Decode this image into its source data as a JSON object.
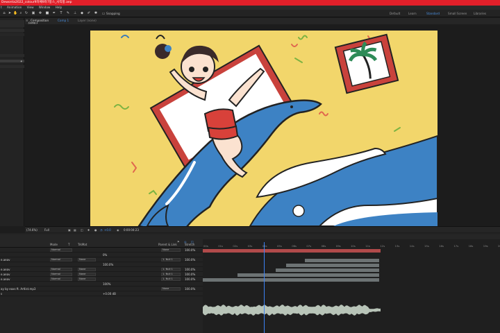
{
  "title_bar": {
    "text": "Dewonta2022_colour9차예9차7방스_사직항.aep"
  },
  "menu": {
    "items": [
      "t",
      "Animation",
      "View",
      "Window",
      "Help"
    ]
  },
  "toolbar": {
    "snapping_label": "Snapping",
    "workspaces": [
      {
        "label": "Default",
        "active": false
      },
      {
        "label": "Learn",
        "active": false
      },
      {
        "label": "Standard",
        "active": true
      },
      {
        "label": "Small Screen",
        "active": false
      },
      {
        "label": "Libraries",
        "active": false
      }
    ]
  },
  "composition_panel": {
    "panel_tab": "Composition",
    "comp_tab": "Comp 1",
    "layer_tab": "Layer (none)",
    "view_tab": "Comp 1"
  },
  "viewer_bar": {
    "zoom": "(74.6%)",
    "resolution": "Full",
    "exposure": "+0.0",
    "timecode": "0:00:04:23"
  },
  "timeline": {
    "columns": {
      "mode": "Mode",
      "trkmat": "TrkMat",
      "parent": "Parent & Link",
      "switches": "Stretch",
      "blend": "T"
    },
    "time_ticks": [
      "00s",
      "01s",
      "02s",
      "03s",
      "04s",
      "05s",
      "06s",
      "07s",
      "08s",
      "09s",
      "10s",
      "11s",
      "12s",
      "13s",
      "14s",
      "15s",
      "16s",
      "17s",
      "18s",
      "19s",
      "20s"
    ],
    "playhead_time": "04s",
    "layers": [
      {
        "name": "",
        "mode": "Normal",
        "trkmat": "",
        "parent": "None",
        "stretch": "100.0%",
        "sub": "",
        "bar": {
          "color": "#b14a4a",
          "start": 0,
          "end": 12.2
        }
      },
      {
        "name": "",
        "mode": "",
        "trkmat": "",
        "parent": "",
        "stretch": "",
        "sub": "0%",
        "bar": null
      },
      {
        "name": "e.aeav",
        "mode": "Normal",
        "trkmat": "None",
        "parent": "1. Null 1",
        "stretch": "100.0%",
        "sub": "",
        "bar": {
          "color": "#6d7374",
          "start": 7.0,
          "end": 12.1
        }
      },
      {
        "name": "",
        "mode": "",
        "trkmat": "",
        "parent": "",
        "stretch": "",
        "sub": "100.0%",
        "bar": {
          "color": "#6d7374",
          "start": 5.7,
          "end": 12.1
        }
      },
      {
        "name": "e.aeav",
        "mode": "Normal",
        "trkmat": "None",
        "parent": "1. Null 1",
        "stretch": "100.0%",
        "sub": "",
        "bar": {
          "color": "#6d7374",
          "start": 5.0,
          "end": 12.1
        }
      },
      {
        "name": "e.aeav",
        "mode": "Normal",
        "trkmat": "None",
        "parent": "1. Null 1",
        "stretch": "100.0%",
        "sub": "",
        "bar": {
          "color": "#6d7374",
          "start": 2.4,
          "end": 12.1
        }
      },
      {
        "name": "e.aeav",
        "mode": "Normal",
        "trkmat": "None",
        "parent": "1. Null 1",
        "stretch": "100.0%",
        "sub": "",
        "bar": {
          "color": "#6d7374",
          "start": 0,
          "end": 12.1
        }
      },
      {
        "name": "",
        "mode": "",
        "trkmat": "",
        "parent": "",
        "stretch": "",
        "sub": "100%",
        "bar": null
      },
      {
        "name": "ay by eaxs ft. Artlist.mp3",
        "mode": "",
        "trkmat": "",
        "parent": "None",
        "stretch": "100.0%",
        "sub": "",
        "bar": null
      },
      {
        "name": "s",
        "mode": "",
        "trkmat": "",
        "parent": "",
        "stretch": "",
        "sub": "+0.00 dB",
        "bar": null
      }
    ]
  }
}
